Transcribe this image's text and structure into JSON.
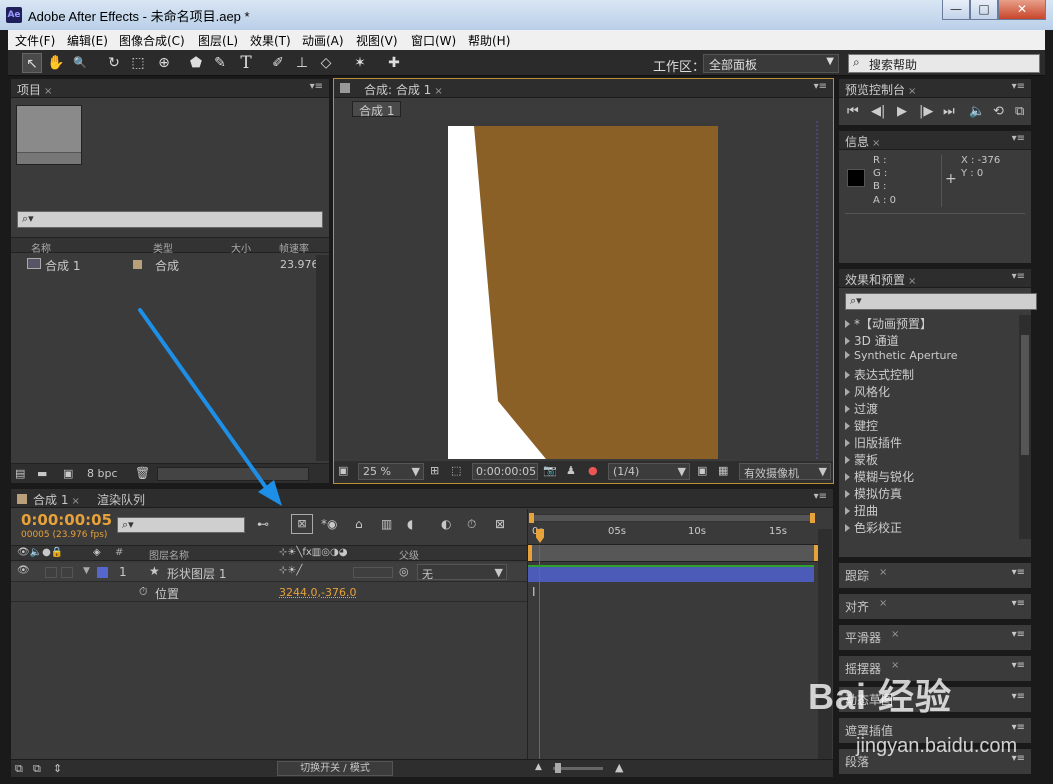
{
  "window": {
    "title": "Adobe After Effects - 未命名项目.aep *",
    "app_icon_text": "Ae",
    "minimize": "—",
    "maximize": "□",
    "close": "✕"
  },
  "menu": [
    "文件(F)",
    "编辑(E)",
    "图像合成(C)",
    "图层(L)",
    "效果(T)",
    "动画(A)",
    "视图(V)",
    "窗口(W)",
    "帮助(H)"
  ],
  "toolbar": {
    "tools": [
      "↖",
      "✋",
      "🔍",
      "↻",
      "⬚",
      "⊕",
      "⬟",
      "✎",
      "T",
      "✐",
      "⊥",
      "◇",
      "✶",
      "✚"
    ],
    "workspace_label": "工作区：",
    "workspace_value": "全部面板",
    "search_placeholder": "搜索帮助"
  },
  "project_panel": {
    "tab": "项目",
    "search_placeholder": "⌕▾",
    "col_name": "名称",
    "col_type": "类型",
    "col_size": "大小",
    "col_fps": "帧速率",
    "item_name": "合成 1",
    "item_type": "合成",
    "item_fps": "23.976",
    "bpc": "8 bpc"
  },
  "comp_panel": {
    "tab": "合成: 合成 1",
    "subtab": "合成 1",
    "zoom": "25 %",
    "timecode": "0:00:00:05",
    "resolution": "(1/4)",
    "camera": "有效摄像机",
    "colors": {
      "background": "#3a3a3a",
      "white_shape": "#ffffff",
      "brown_layer": "#8b6026"
    }
  },
  "preview_panel": {
    "tab": "预览控制台",
    "buttons": [
      "⏮",
      "◀|",
      "▶",
      "|▶",
      "⏭",
      "🔈",
      "⟲",
      "⧉"
    ]
  },
  "info_panel": {
    "tab": "信息",
    "r": "R :",
    "g": "G :",
    "b": "B :",
    "a": "A : 0",
    "x": "X : -376",
    "y": "Y : 0"
  },
  "effects_panel": {
    "tab": "效果和预置",
    "search_placeholder": "⌕▾",
    "items": [
      "*【动画预置】",
      "3D 通道",
      "Synthetic Aperture",
      "表达式控制",
      "风格化",
      "过渡",
      "键控",
      "旧版插件",
      "蒙板",
      "模糊与锐化",
      "模拟仿真",
      "扭曲",
      "色彩校正"
    ]
  },
  "side_panels": [
    "跟踪",
    "对齐",
    "平滑器",
    "摇摆器",
    "动态草图",
    "遮罩插值",
    "段落"
  ],
  "timeline": {
    "tab_comp": "合成 1",
    "tab_render": "渲染队列",
    "timecode": "0:00:00:05",
    "fps_info": "00005 (23.976 fps)",
    "search_placeholder": "⌕▾",
    "col_layer_name": "图层名称",
    "col_parent": "父级",
    "col_hash": "#",
    "layer_num": "1",
    "layer_name": "形状图层 1",
    "parent_value": "无",
    "property_name": "位置",
    "property_value": "3244.0,-376.0",
    "ruler": [
      "0s",
      "05s",
      "10s",
      "15s"
    ],
    "footer": "切换开关 / 模式"
  },
  "watermark": {
    "brand": "Bai  经验",
    "url": "jingyan.baidu.com"
  }
}
